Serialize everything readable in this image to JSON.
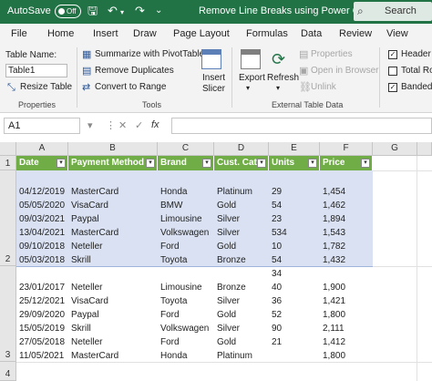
{
  "titlebar": {
    "autosave_label": "AutoSave",
    "autosave_state": "Off",
    "doc_title": "Remove Line Breaks using Power Query",
    "search_label": "Search"
  },
  "menu": {
    "tabs": [
      "File",
      "Home",
      "Insert",
      "Draw",
      "Page Layout",
      "Formulas",
      "Data",
      "Review",
      "View"
    ]
  },
  "ribbon": {
    "table_name_label": "Table Name:",
    "table_name_value": "Table1",
    "resize_table": "Resize Table",
    "properties_group": "Properties",
    "summarize_pivot": "Summarize with PivotTable",
    "remove_duplicates": "Remove Duplicates",
    "convert_to_range": "Convert to Range",
    "tools_group": "Tools",
    "insert_slicer_1": "Insert",
    "insert_slicer_2": "Slicer",
    "export": "Export",
    "refresh": "Refresh",
    "properties": "Properties",
    "open_in_browser": "Open in Browser",
    "unlink": "Unlink",
    "external_group": "External Table Data",
    "header_row": "Header R",
    "total_row": "Total Ro",
    "banded_rows": "Banded"
  },
  "formula_bar": {
    "name_box": "A1",
    "cancel_symbol": "✕",
    "enter_symbol": "✓",
    "fx_symbol": "fx",
    "formula": ""
  },
  "columns": [
    "A",
    "B",
    "C",
    "D",
    "E",
    "F",
    "G"
  ],
  "row_numbers": [
    "1",
    "2",
    "3",
    "4"
  ],
  "table": {
    "headers": [
      "Date",
      "Payment Method",
      "Brand",
      "Cust. Cat.",
      "Units",
      "Price"
    ],
    "row2": {
      "Date": [
        "04/12/2019",
        "05/05/2020",
        "09/03/2021",
        "13/04/2021",
        "09/10/2018",
        "05/03/2018"
      ],
      "Payment Method": [
        "MasterCard",
        "VisaCard",
        "Paypal",
        "MasterCard",
        "Neteller",
        "Skrill"
      ],
      "Brand": [
        "Honda",
        "BMW",
        "Limousine",
        "Volkswagen",
        "Ford",
        "Toyota"
      ],
      "Cust. Cat.": [
        "Platinum",
        "Gold",
        "Silver",
        "Silver",
        "Gold",
        "Bronze"
      ],
      "Units": [
        "29",
        "54",
        "23",
        "534",
        "10",
        "54"
      ],
      "Price": [
        "1,454",
        "1,462",
        "1,894",
        "1,543",
        "1,782",
        "1,432"
      ]
    },
    "row3": {
      "Date": [
        "23/01/2017",
        "25/12/2021",
        "29/09/2020",
        "15/05/2019",
        "27/05/2018",
        "11/05/2021"
      ],
      "Payment Method": [
        "Neteller",
        "VisaCard",
        "Paypal",
        "Skrill",
        "Neteller",
        "MasterCard"
      ],
      "Brand": [
        "Limousine",
        "Toyota",
        "Ford",
        "Volkswagen",
        "Ford",
        "Honda"
      ],
      "Cust. Cat.": [
        "Bronze",
        "Silver",
        "Gold",
        "Silver",
        "Gold",
        "Platinum"
      ],
      "Units": [
        "34",
        "40",
        "36",
        "52",
        "90",
        "21"
      ],
      "Price": [
        "1,900",
        "1,421",
        "1,800",
        "2,111",
        "1,412",
        "1,800"
      ]
    }
  }
}
